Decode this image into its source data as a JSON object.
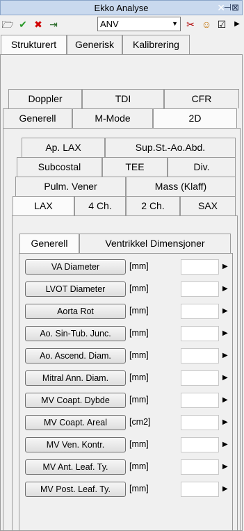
{
  "window": {
    "title": "Ekko Analyse",
    "close_icon": "close-icon",
    "pin_icon": "pin-icon"
  },
  "toolbar": {
    "combo_value": "ANV",
    "icons": [
      "folder-open-icon",
      "check-doc-icon",
      "delete-doc-icon",
      "export-doc-icon",
      "tool-icon",
      "person-icon",
      "edit-icon",
      "more-arrow-icon"
    ]
  },
  "tabs_level1": [
    "Strukturert",
    "Generisk",
    "Kalibrering"
  ],
  "tabs_level2_row1": [
    "Doppler",
    "TDI",
    "CFR"
  ],
  "tabs_level2_row2": [
    "Generell",
    "M-Mode",
    "2D"
  ],
  "tabs_level3_row1": [
    "Ap. LAX",
    "Sup.St.-Ao.Abd."
  ],
  "tabs_level3_row2": [
    "Subcostal",
    "TEE",
    "Div."
  ],
  "tabs_level3_row3": [
    "Pulm. Vener",
    "Mass (Klaff)"
  ],
  "tabs_level3_row4": [
    "LAX",
    "4 Ch.",
    "2 Ch.",
    "SAX"
  ],
  "tabs_level4": [
    "Generell",
    "Ventrikkel Dimensjoner"
  ],
  "measurements": [
    {
      "label": "VA Diameter",
      "unit": "[mm]",
      "value": ""
    },
    {
      "label": "LVOT Diameter",
      "unit": "[mm]",
      "value": ""
    },
    {
      "label": "Aorta Rot",
      "unit": "[mm]",
      "value": ""
    },
    {
      "label": "Ao. Sin-Tub. Junc.",
      "unit": "[mm]",
      "value": ""
    },
    {
      "label": "Ao. Ascend. Diam.",
      "unit": "[mm]",
      "value": ""
    },
    {
      "label": "Mitral Ann. Diam.",
      "unit": "[mm]",
      "value": ""
    },
    {
      "label": "MV Coapt. Dybde",
      "unit": "[mm]",
      "value": ""
    },
    {
      "label": "MV Coapt. Areal",
      "unit": "[cm2]",
      "value": ""
    },
    {
      "label": "MV Ven. Kontr.",
      "unit": "[mm]",
      "value": ""
    },
    {
      "label": "MV Ant. Leaf. Ty.",
      "unit": "[mm]",
      "value": ""
    },
    {
      "label": "MV Post. Leaf. Ty.",
      "unit": "[mm]",
      "value": ""
    }
  ]
}
